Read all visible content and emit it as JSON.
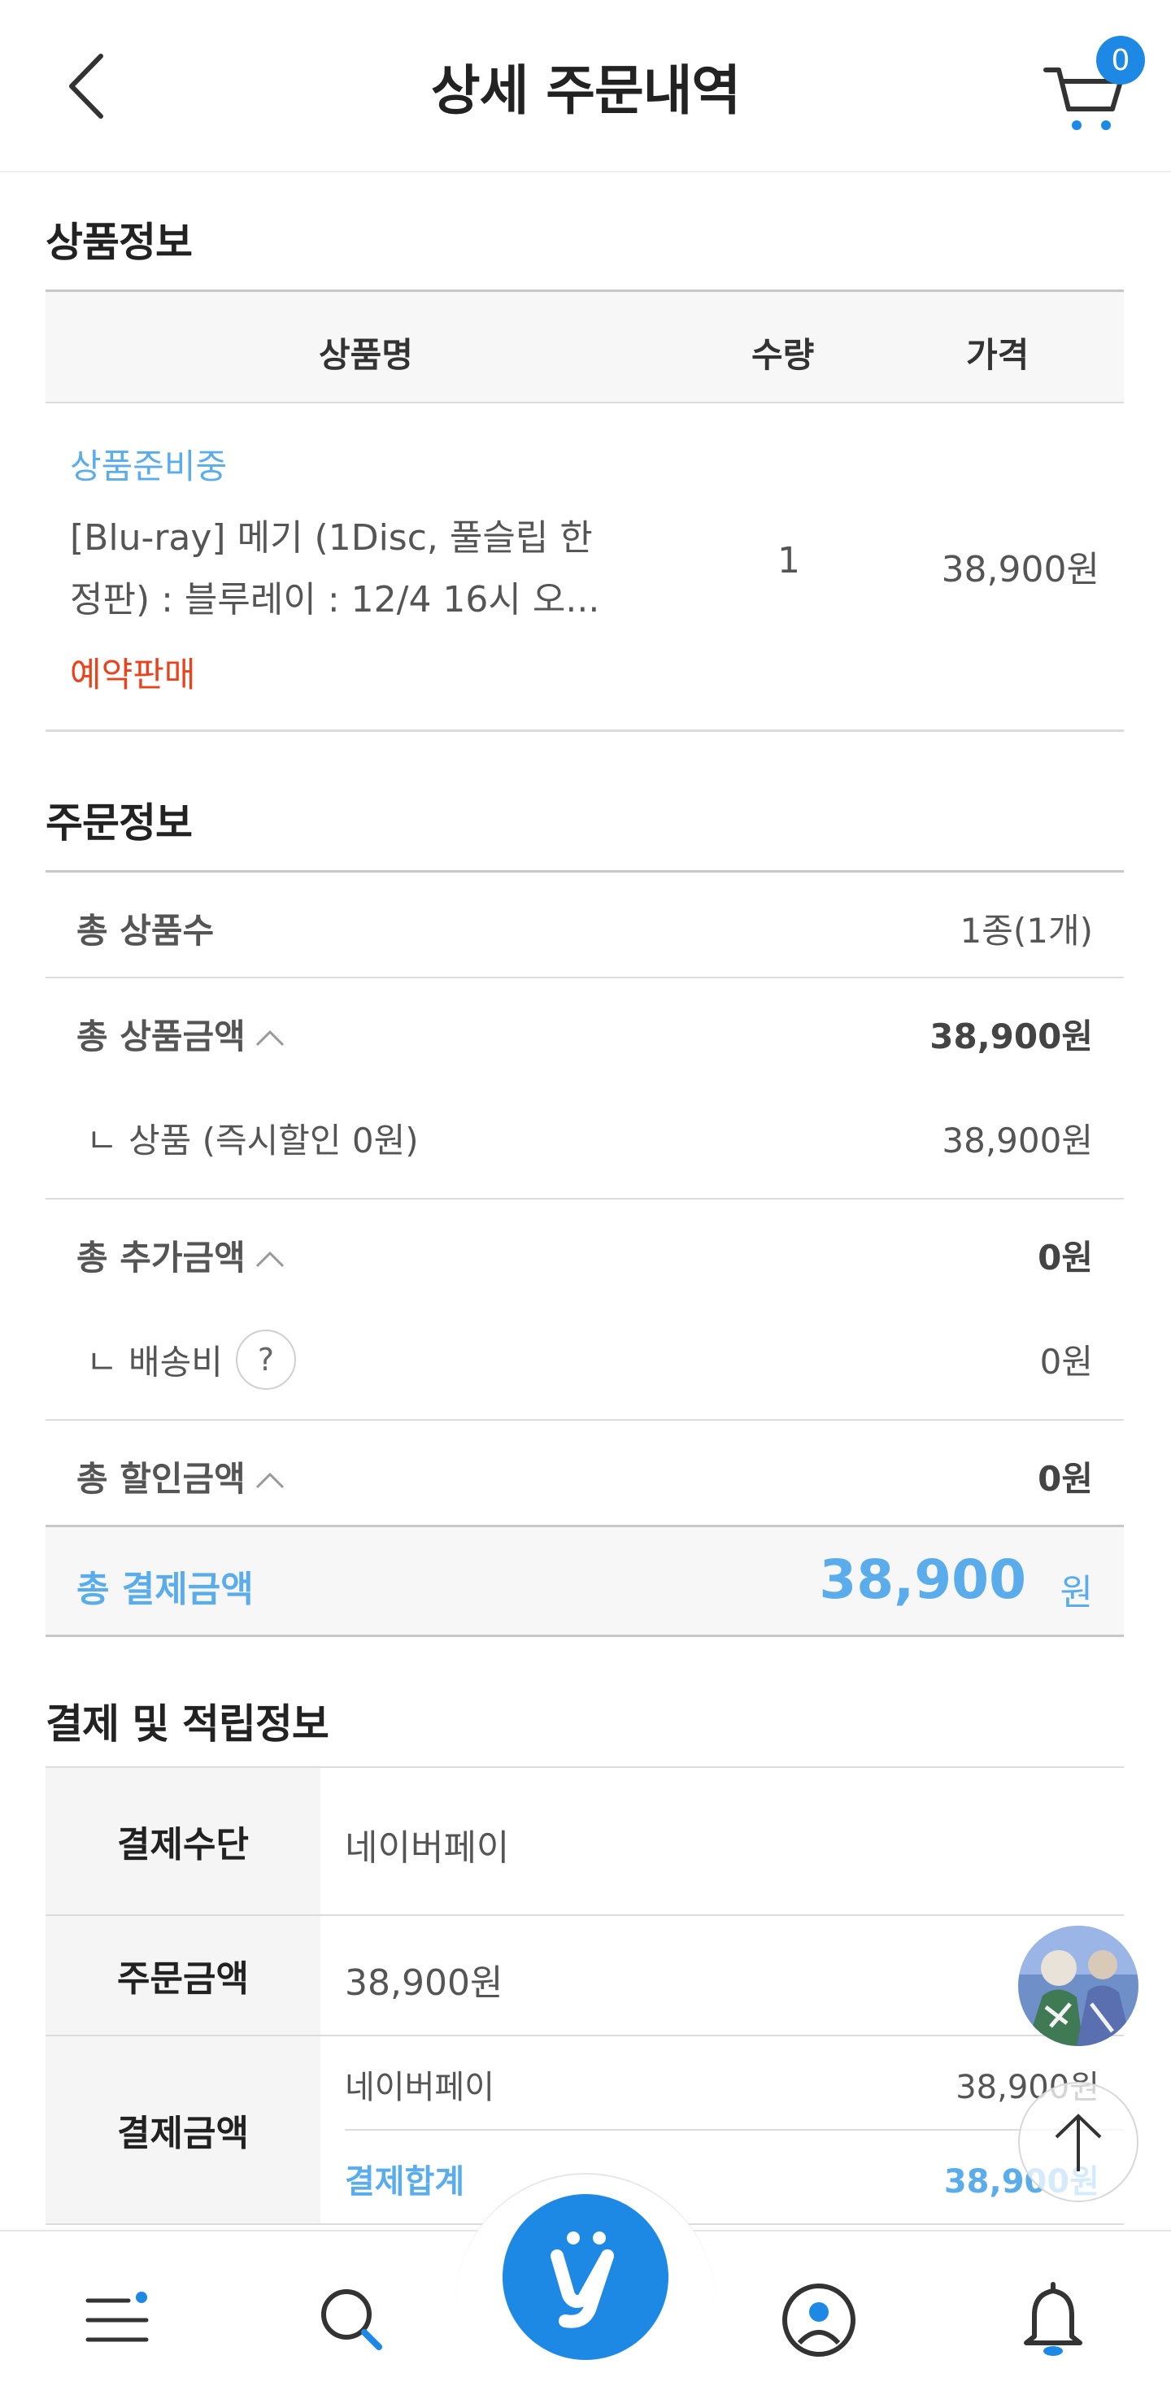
{
  "header": {
    "title": "상세 주문내역",
    "cart_count": "0"
  },
  "product_section": {
    "title": "상품정보",
    "columns": [
      "상품명",
      "수량",
      "가격"
    ],
    "item": {
      "status": "상품준비중",
      "name_line1": "[Blu-ray] 메기 (1Disc, 풀슬립 한",
      "name_line2": "정판) : 블루레이 : 12/4 16시 오...",
      "tag": "예약판매",
      "quantity": "1",
      "price": "38,900원"
    }
  },
  "order_section": {
    "title": "주문정보",
    "total_count_label": "총 상품수",
    "total_count_value": "1종(1개)",
    "total_product_label": "총 상품금액",
    "total_product_value": "38,900원",
    "product_sub_label": "ㄴ 상품 (즉시할인 0원)",
    "product_sub_value": "38,900원",
    "total_extra_label": "총 추가금액",
    "total_extra_value": "0원",
    "shipping_label": "ㄴ 배송비",
    "shipping_help": "?",
    "shipping_value": "0원",
    "total_discount_label": "총 할인금액",
    "total_discount_value": "0원",
    "grand_total_label": "총 결제금액",
    "grand_total_amount": "38,900",
    "grand_total_unit": "원",
    "caret": "^"
  },
  "payment_section": {
    "title": "결제 및 적립정보",
    "method_label": "결제수단",
    "method_value": "네이버페이",
    "order_amount_label": "주문금액",
    "order_amount_value": "38,900원",
    "pay_amount_label": "결제금액",
    "pay_line_name": "네이버페이",
    "pay_line_value": "38,900원",
    "pay_total_label": "결제합계",
    "pay_total_value": "38,900원"
  },
  "colors": {
    "accent_blue": "#5aacea",
    "brand_blue": "#1e88e5",
    "reserve_red": "#e8431c"
  },
  "nav": {
    "items": [
      "menu-icon",
      "search-icon",
      "home-logo",
      "my-page-icon",
      "notification-icon"
    ]
  }
}
